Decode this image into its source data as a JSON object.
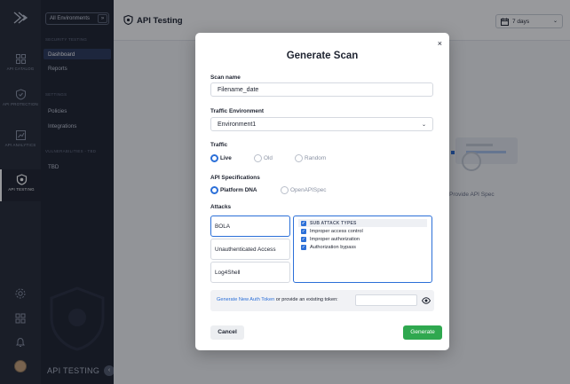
{
  "rail": {
    "items": [
      {
        "label": "API CATALOG",
        "icon": "grid-icon"
      },
      {
        "label": "API PROTECTION",
        "icon": "shield-check-icon"
      },
      {
        "label": "API ANALYTICS",
        "icon": "chart-icon"
      },
      {
        "label": "API TESTING",
        "icon": "shield-target-icon",
        "active": true
      }
    ],
    "bottom_icons": [
      "settings-icon",
      "apps-icon",
      "bell-icon"
    ]
  },
  "nav": {
    "env_selector": "All Environments",
    "sections": {
      "security_testing": "SECURITY TESTING",
      "settings": "SETTINGS",
      "vulnerabilities": "VULNERABILITIES - TBD"
    },
    "links": {
      "dashboard": "Dashboard",
      "reports": "Reports",
      "policies": "Policies",
      "integrations": "Integrations",
      "tbd": "TBD"
    },
    "footer": "API TESTING"
  },
  "header": {
    "title": "API Testing",
    "date_range": "7 days"
  },
  "background": {
    "card_text": "Provide API Spec"
  },
  "modal": {
    "title": "Generate Scan",
    "close": "×",
    "scan_name_label": "Scan name",
    "scan_name_value": "Filename_date",
    "traffic_env_label": "Traffic Environment",
    "traffic_env_value": "Environment1",
    "traffic_label": "Traffic",
    "traffic_options": [
      {
        "label": "Live",
        "selected": true
      },
      {
        "label": "Old",
        "selected": false
      },
      {
        "label": "Random",
        "selected": false
      }
    ],
    "api_spec_label": "API Specifications",
    "api_spec_options": [
      {
        "label": "Platform DNA",
        "selected": true
      },
      {
        "label": "OpenAPISpec",
        "selected": false
      }
    ],
    "attacks_label": "Attacks",
    "attacks": [
      {
        "label": "BOLA",
        "selected": true
      },
      {
        "label": "Unauthenticated Access",
        "selected": false
      },
      {
        "label": "Log4Shell",
        "selected": false
      }
    ],
    "sub_attacks": {
      "header": "SUB ATTACK TYPES",
      "items": [
        {
          "label": "Improper access control",
          "checked": true
        },
        {
          "label": "Improper authorization",
          "checked": true
        },
        {
          "label": "Authorization bypass",
          "checked": true
        }
      ]
    },
    "token": {
      "link": "Generate New Auth Token",
      "text": "or provide an existing token:",
      "value": ""
    },
    "cancel": "Cancel",
    "generate": "Generate"
  },
  "colors": {
    "primary": "#2b6fd8",
    "success": "#2fa84f",
    "rail_bg": "#262b38",
    "nav_bg": "#1e2330"
  }
}
